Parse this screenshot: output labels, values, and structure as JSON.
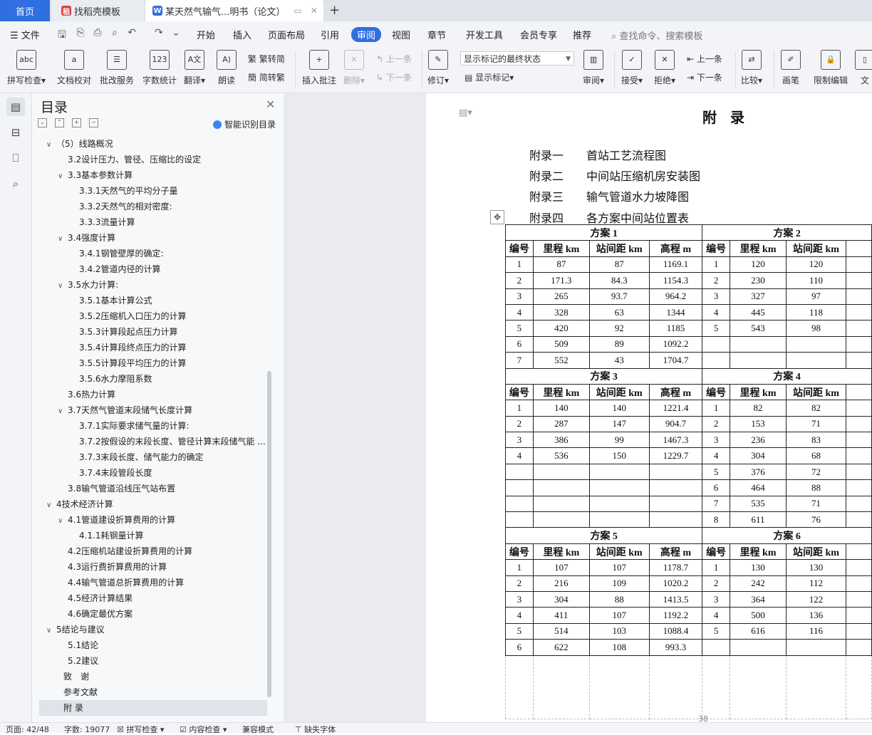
{
  "tabs": {
    "home": "首页",
    "template": "找稻壳模板",
    "document": "某天然气输气...明书（论文）",
    "new_tab": "+"
  },
  "menu": {
    "file": "文件",
    "items": [
      "开始",
      "插入",
      "页面布局",
      "引用",
      "审阅",
      "视图",
      "章节",
      "开发工具",
      "会员专享",
      "推荐"
    ],
    "active": "审阅",
    "search_placeholder": "查找命令、搜索模板"
  },
  "ribbon": {
    "spell_check": "拼写检查",
    "doc_proof": "文档校对",
    "batch_service": "批改服务",
    "word_count": "字数统计",
    "translate": "翻译",
    "read_aloud": "朗读",
    "trad_to_simp": "繁转简",
    "simp_to_trad": "简转繁",
    "insert_comment": "插入批注",
    "delete": "删除",
    "prev": "上一条",
    "next": "下一条",
    "track": "修订",
    "markup_state": "显示标记的最终状态",
    "show_markup": "显示标记",
    "review": "审阅",
    "accept": "接受",
    "reject": "拒绝",
    "prev2": "上一条",
    "next2": "下一条",
    "compare": "比较",
    "pen": "画笔",
    "restrict_edit": "限制编辑",
    "doc_right": "文"
  },
  "toc": {
    "title": "目录",
    "smart": "智能识别目录",
    "items": [
      {
        "text": "（5）线路概况",
        "level": 1,
        "caret": "∨"
      },
      {
        "text": "3.2设计压力、管径、压缩比的设定",
        "level": 2,
        "caret": ""
      },
      {
        "text": "3.3基本参数计算",
        "level": 2,
        "caret": "∨"
      },
      {
        "text": "3.3.1天然气的平均分子量",
        "level": 3,
        "caret": ""
      },
      {
        "text": "3.3.2天然气的相对密度:",
        "level": 3,
        "caret": ""
      },
      {
        "text": "3.3.3流量计算",
        "level": 3,
        "caret": ""
      },
      {
        "text": "3.4强度计算",
        "level": 2,
        "caret": "∨"
      },
      {
        "text": "3.4.1钢管壁厚的确定:",
        "level": 3,
        "caret": ""
      },
      {
        "text": "3.4.2管道内径的计算",
        "level": 3,
        "caret": ""
      },
      {
        "text": "3.5水力计算:",
        "level": 2,
        "caret": "∨"
      },
      {
        "text": "3.5.1基本计算公式",
        "level": 3,
        "caret": ""
      },
      {
        "text": "3.5.2压缩机入口压力的计算",
        "level": 3,
        "caret": ""
      },
      {
        "text": "3.5.3计算段起点压力计算",
        "level": 3,
        "caret": ""
      },
      {
        "text": "3.5.4计算段终点压力的计算",
        "level": 3,
        "caret": ""
      },
      {
        "text": "3.5.5计算段平均压力的计算",
        "level": 3,
        "caret": ""
      },
      {
        "text": "3.5.6水力摩阻系数",
        "level": 3,
        "caret": ""
      },
      {
        "text": "3.6热力计算",
        "level": 2,
        "caret": ""
      },
      {
        "text": "3.7天然气管道末段储气长度计算",
        "level": 2,
        "caret": "∨"
      },
      {
        "text": "3.7.1实际要求储气量的计算:",
        "level": 3,
        "caret": ""
      },
      {
        "text": "3.7.2按假设的末段长度、管径计算末段储气能 ...",
        "level": 3,
        "caret": ""
      },
      {
        "text": "3.7.3末段长度、储气能力的确定",
        "level": 3,
        "caret": ""
      },
      {
        "text": "3.7.4末段管段长度",
        "level": 3,
        "caret": ""
      },
      {
        "text": "3.8输气管道沿线压气站布置",
        "level": 2,
        "caret": ""
      },
      {
        "text": "4技术经济计算",
        "level": 1,
        "caret": "∨"
      },
      {
        "text": "4.1管道建设折算费用的计算",
        "level": 2,
        "caret": "∨"
      },
      {
        "text": "4.1.1耗钢量计算",
        "level": 3,
        "caret": ""
      },
      {
        "text": "4.2压缩机站建设折算费用的计算",
        "level": 2,
        "caret": ""
      },
      {
        "text": "4.3运行费折算费用的计算",
        "level": 2,
        "caret": ""
      },
      {
        "text": "4.4输气管道总折算费用的计算",
        "level": 2,
        "caret": ""
      },
      {
        "text": "4.5经济计算结果",
        "level": 2,
        "caret": ""
      },
      {
        "text": "4.6确定最优方案",
        "level": 2,
        "caret": ""
      },
      {
        "text": "5结论与建议",
        "level": 1,
        "caret": "∨"
      },
      {
        "text": "5.1结论",
        "level": 2,
        "caret": ""
      },
      {
        "text": "5.2建议",
        "level": 2,
        "caret": ""
      },
      {
        "text": "致　谢",
        "level": 0,
        "caret": ""
      },
      {
        "text": "参考文献",
        "level": 0,
        "caret": ""
      },
      {
        "text": "附 录",
        "level": 0,
        "caret": "",
        "selected": true
      }
    ]
  },
  "page": {
    "heading": "附 录",
    "appendix": [
      {
        "num": "附录一",
        "title": "首站工艺流程图"
      },
      {
        "num": "附录二",
        "title": "中间站压缩机房安装图"
      },
      {
        "num": "附录三",
        "title": "输气管道水力坡降图"
      },
      {
        "num": "附录四",
        "title": "各方案中间站位置表"
      }
    ],
    "page_number": "38"
  },
  "table": {
    "headers": [
      "编号",
      "里程 km",
      "站间距 km",
      "高程 m"
    ],
    "blocks": [
      {
        "left_title": "方案 1",
        "right_title": "方案 2",
        "left_rows": [
          [
            "1",
            "87",
            "87",
            "1169.1"
          ],
          [
            "2",
            "171.3",
            "84.3",
            "1154.3"
          ],
          [
            "3",
            "265",
            "93.7",
            "964.2"
          ],
          [
            "4",
            "328",
            "63",
            "1344"
          ],
          [
            "5",
            "420",
            "92",
            "1185"
          ],
          [
            "6",
            "509",
            "89",
            "1092.2"
          ],
          [
            "7",
            "552",
            "43",
            "1704.7"
          ]
        ],
        "right_rows": [
          [
            "1",
            "120",
            "120"
          ],
          [
            "2",
            "230",
            "110"
          ],
          [
            "3",
            "327",
            "97"
          ],
          [
            "4",
            "445",
            "118"
          ],
          [
            "5",
            "543",
            "98"
          ],
          [
            "",
            "",
            " "
          ],
          [
            "",
            "",
            ""
          ]
        ],
        "rows": 7
      },
      {
        "left_title": "方案 3",
        "right_title": "方案 4",
        "left_rows": [
          [
            "1",
            "140",
            "140",
            "1221.4"
          ],
          [
            "2",
            "287",
            "147",
            "904.7"
          ],
          [
            "3",
            "386",
            "99",
            "1467.3"
          ],
          [
            "4",
            "536",
            "150",
            "1229.7"
          ],
          [
            "",
            "",
            "",
            ""
          ],
          [
            "",
            "",
            "",
            ""
          ],
          [
            "",
            "",
            "",
            ""
          ],
          [
            "",
            "",
            "",
            ""
          ]
        ],
        "right_rows": [
          [
            "1",
            "82",
            "82"
          ],
          [
            "2",
            "153",
            "71"
          ],
          [
            "3",
            "236",
            "83"
          ],
          [
            "4",
            "304",
            "68"
          ],
          [
            "5",
            "376",
            "72"
          ],
          [
            "6",
            "464",
            "88"
          ],
          [
            "7",
            "535",
            "71"
          ],
          [
            "8",
            "611",
            "76"
          ]
        ],
        "rows": 8
      },
      {
        "left_title": "方案 5",
        "right_title": "方案 6",
        "left_rows": [
          [
            "1",
            "107",
            "107",
            "1178.7"
          ],
          [
            "2",
            "216",
            "109",
            "1020.2"
          ],
          [
            "3",
            "304",
            "88",
            "1413.5"
          ],
          [
            "4",
            "411",
            "107",
            "1192.2"
          ],
          [
            "5",
            "514",
            "103",
            "1088.4"
          ],
          [
            "6",
            "622",
            "108",
            "993.3"
          ]
        ],
        "right_rows": [
          [
            "1",
            "130",
            "130"
          ],
          [
            "2",
            "242",
            "112"
          ],
          [
            "3",
            "364",
            "122"
          ],
          [
            "4",
            "500",
            "136"
          ],
          [
            "5",
            "616",
            "116"
          ],
          [
            "",
            "",
            ""
          ]
        ],
        "rows": 6
      }
    ]
  },
  "status": {
    "page": "页面: 42/48",
    "words": "字数: 19077",
    "spell": "拼写检查",
    "content_check": "内容检查",
    "compat": "兼容模式",
    "missing_font": "缺失字体"
  }
}
